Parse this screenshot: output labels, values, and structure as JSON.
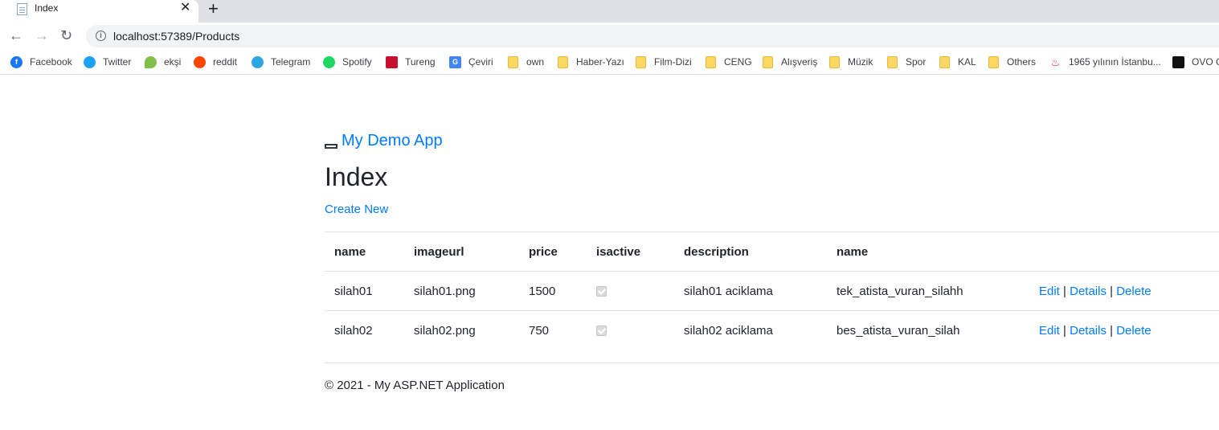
{
  "browser": {
    "tab_title": "Index",
    "tab_close": "✕",
    "new_tab": "+",
    "url": "localhost:57389/Products",
    "bookmarks": [
      {
        "label": "Facebook",
        "icon": "facebook-icon",
        "color": "#1877f2"
      },
      {
        "label": "Twitter",
        "icon": "twitter-icon",
        "color": "#1da1f2"
      },
      {
        "label": "ekşi",
        "icon": "eksi-icon",
        "color": "#81c14b"
      },
      {
        "label": "reddit",
        "icon": "reddit-icon",
        "color": "#ff4500"
      },
      {
        "label": "Telegram",
        "icon": "telegram-icon",
        "color": "#2ca5e0"
      },
      {
        "label": "Spotify",
        "icon": "spotify-icon",
        "color": "#1ed760"
      },
      {
        "label": "Tureng",
        "icon": "tureng-icon",
        "color": "#c8102e"
      },
      {
        "label": "Çeviri",
        "icon": "translate-icon",
        "color": "#4285f4"
      },
      {
        "label": "own",
        "icon": "folder-icon"
      },
      {
        "label": "Haber-Yazı",
        "icon": "folder-icon"
      },
      {
        "label": "Film-Dizi",
        "icon": "folder-icon"
      },
      {
        "label": "CENG",
        "icon": "folder-icon"
      },
      {
        "label": "Alışveriş",
        "icon": "folder-icon"
      },
      {
        "label": "Müzik",
        "icon": "folder-icon"
      },
      {
        "label": "Spor",
        "icon": "folder-icon"
      },
      {
        "label": "KAL",
        "icon": "folder-icon"
      },
      {
        "label": "Others",
        "icon": "folder-icon"
      },
      {
        "label": "1965 yılının İstanbu...",
        "icon": "flame-icon",
        "color": "#d32f2f"
      },
      {
        "label": "OVO G",
        "icon": "ovo-icon",
        "color": "#111111"
      }
    ]
  },
  "page": {
    "brand": "My Demo App",
    "title": "Index",
    "create_link": "Create New",
    "table": {
      "headers": [
        "name",
        "imageurl",
        "price",
        "isactive",
        "description",
        "name"
      ],
      "rows": [
        {
          "name": "silah01",
          "imageurl": "silah01.png",
          "price": "1500",
          "isactive": true,
          "description": "silah01 aciklama",
          "category": "tek_atista_vuran_silahh"
        },
        {
          "name": "silah02",
          "imageurl": "silah02.png",
          "price": "750",
          "isactive": true,
          "description": "silah02 aciklama",
          "category": "bes_atista_vuran_silah"
        }
      ],
      "actions": {
        "edit": "Edit",
        "details": "Details",
        "delete": "Delete",
        "separator": "|"
      }
    },
    "footer": "© 2021 - My ASP.NET Application"
  },
  "colors": {
    "link": "#007bff",
    "text": "#212529",
    "border": "#dee2e6"
  }
}
